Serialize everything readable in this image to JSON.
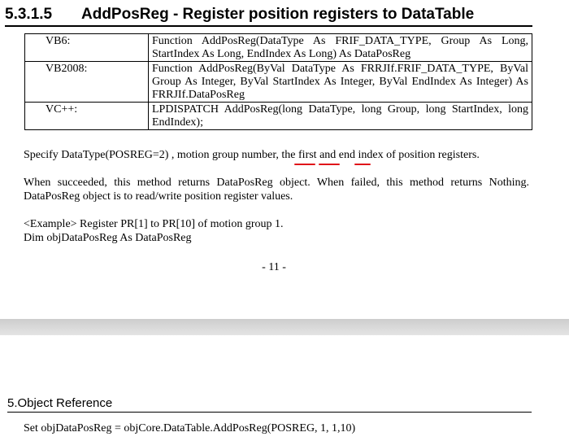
{
  "heading": {
    "number": "5.3.1.5",
    "title": "AddPosReg - Register position registers to DataTable"
  },
  "signature_table": [
    {
      "lang": "VB6:",
      "code": "Function AddPosReg(DataType As FRIF_DATA_TYPE, Group As Long, StartIndex As Long, EndIndex As Long) As DataPosReg"
    },
    {
      "lang": "VB2008:",
      "code": "Function AddPosReg(ByVal DataType As FRRJIf.FRIF_DATA_TYPE, ByVal Group As Integer, ByVal StartIndex As Integer, ByVal EndIndex As Integer) As FRRJIf.DataPosReg"
    },
    {
      "lang": "VC++:",
      "code": "LPDISPATCH AddPosReg(long DataType, long Group, long StartIndex, long EndIndex);"
    }
  ],
  "specify": {
    "text": "Specify DataType(POSREG=2) , motion group number, the first and end index of position registers.",
    "annotation_color": "#e0141a"
  },
  "result_text_1": "When succeeded, this method returns DataPosReg object. When failed, this method returns Nothing.",
  "result_text_2": "DataPosReg object is to read/write position register values.",
  "example_line_1": "<Example> Register PR[1] to PR[10] of motion group 1.",
  "example_line_2": "Dim objDataPosReg As DataPosReg",
  "page_number": "- 11 -",
  "section5_title": "5.Object Reference",
  "code_line": "Set objDataPosReg = objCore.DataTable.AddPosReg(POSREG, 1, 1,10)"
}
